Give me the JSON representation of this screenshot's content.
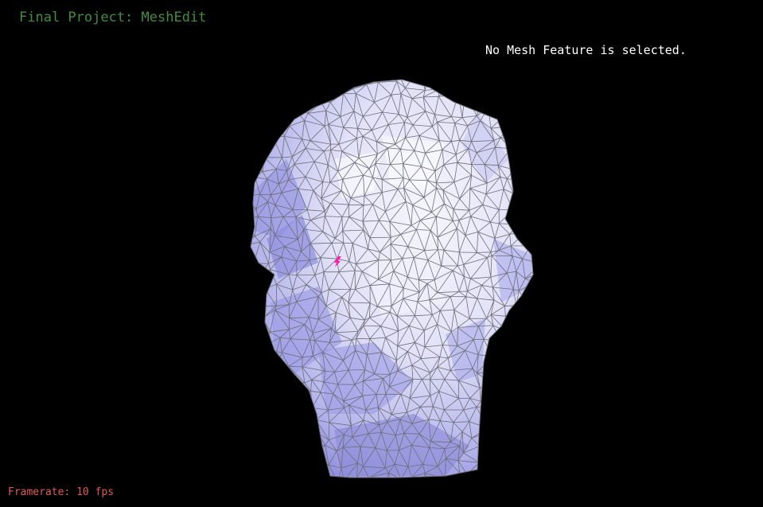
{
  "app": {
    "title": "Final Project: MeshEdit"
  },
  "status": {
    "selection_message": "No Mesh Feature is selected."
  },
  "footer": {
    "framerate_text": "Framerate: 10 fps"
  },
  "colors": {
    "background": "#000000",
    "title": "#3f8f3f",
    "status_text": "#ffffff",
    "framerate": "#e05a5a",
    "mesh_fill_light": "#f4f4fc",
    "mesh_fill_mid": "#c8c8f0",
    "mesh_fill_dark": "#8c8ce0",
    "mesh_edges": "#6e6e78",
    "selection_marker": "#ff1fb0"
  },
  "scene": {
    "model": "head-mesh",
    "rendering": "wireframe-over-shaded"
  }
}
